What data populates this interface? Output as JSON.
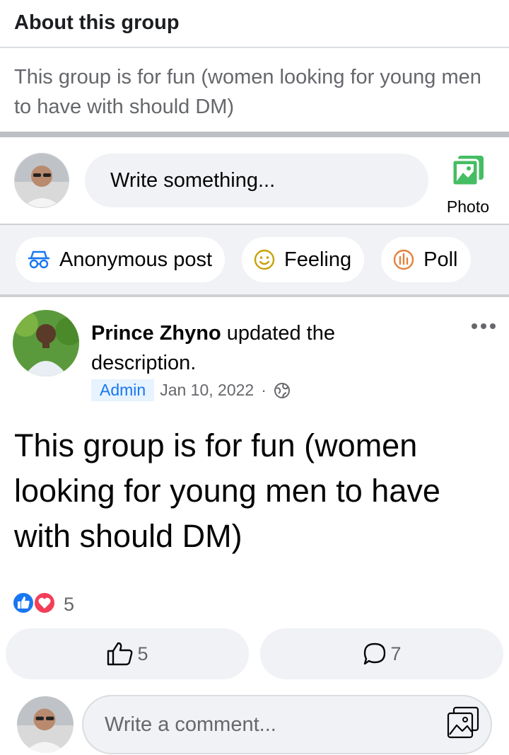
{
  "about": {
    "title": "About this group",
    "description": "This group is for fun (women looking for young men to have with should DM)"
  },
  "composer": {
    "placeholder": "Write something...",
    "photo_label": "Photo",
    "avatar_icon": "user-avatar"
  },
  "chips": [
    {
      "label": "Anonymous post",
      "icon": "anonymous-icon"
    },
    {
      "label": "Feeling",
      "icon": "smiley-icon"
    },
    {
      "label": "Poll",
      "icon": "poll-icon"
    }
  ],
  "post": {
    "author": "Prince Zhyno",
    "action_text": " updated the description.",
    "badge": "Admin",
    "date": "Jan 10, 2022",
    "separator": "·",
    "privacy_icon": "globe-icon",
    "body": "This group is for fun (women looking for young men to have with should DM)",
    "reaction_count": "5",
    "like_count": "5",
    "comment_count": "7"
  },
  "comment": {
    "placeholder": "Write a comment..."
  },
  "colors": {
    "brand_blue": "#1877f2",
    "love_red": "#f33e58",
    "photo_green": "#45bd62",
    "feeling_yellow": "#c7a10a",
    "poll_orange": "#e4813a"
  }
}
